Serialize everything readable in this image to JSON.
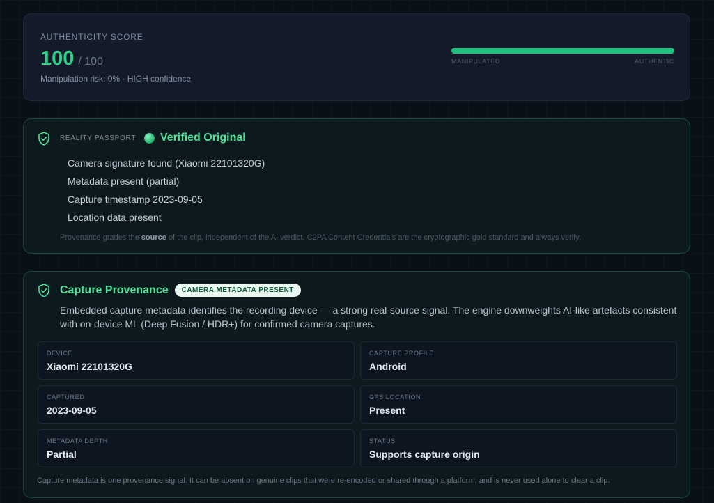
{
  "score": {
    "label": "AUTHENTICITY SCORE",
    "value": "100",
    "max": "/ 100",
    "subtitle": "Manipulation risk: 0% · HIGH confidence",
    "bar_fraction": 1.0,
    "bar_left_label": "MANIPULATED",
    "bar_right_label": "AUTHENTIC",
    "accent_color": "#2fd08a"
  },
  "passport": {
    "kicker": "REALITY PASSPORT",
    "title": "Verified Original",
    "items": [
      "Camera signature found (Xiaomi 22101320G)",
      "Metadata present (partial)",
      "Capture timestamp 2023-09-05",
      "Location data present"
    ],
    "note_before": "Provenance grades the ",
    "note_bold": "source",
    "note_after": " of the clip, independent of the AI verdict. C2PA Content Credentials are the cryptographic gold standard and always verify.",
    "icon": "shield-check-icon"
  },
  "provenance": {
    "title": "Capture Provenance",
    "badge": "CAMERA METADATA PRESENT",
    "description": "Embedded capture metadata identifies the recording device — a strong real-source signal. The engine downweights AI-like artefacts consistent with on-device ML (Deep Fusion / HDR+) for confirmed camera captures.",
    "fields": [
      {
        "label": "DEVICE",
        "value": "Xiaomi 22101320G"
      },
      {
        "label": "CAPTURE PROFILE",
        "value": "Android"
      },
      {
        "label": "CAPTURED",
        "value": "2023-09-05"
      },
      {
        "label": "GPS LOCATION",
        "value": "Present"
      },
      {
        "label": "METADATA DEPTH",
        "value": "Partial"
      },
      {
        "label": "STATUS",
        "value": "Supports capture origin"
      }
    ],
    "footer": "Capture metadata is one provenance signal. It can be absent on genuine clips that were re-encoded or shared through a platform, and is never used alone to clear a clip.",
    "icon": "shield-check-icon"
  }
}
